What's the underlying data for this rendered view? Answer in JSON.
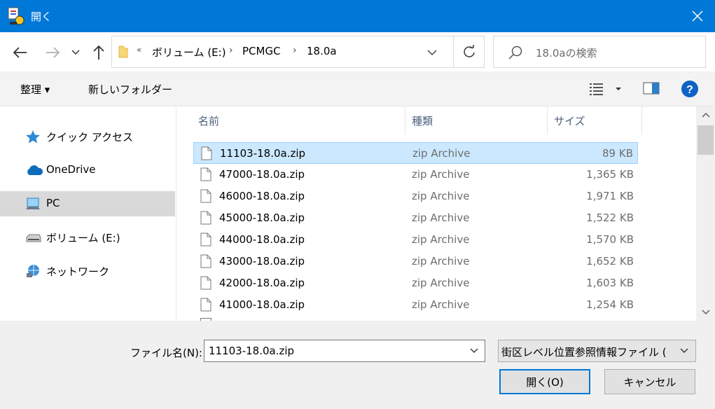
{
  "window": {
    "title": "開く",
    "close_icon": "close-icon"
  },
  "nav": {
    "back_icon": "arrow-left-icon",
    "forward_icon": "arrow-right-icon",
    "recent_icon": "chevron-down-icon",
    "up_icon": "arrow-up-icon"
  },
  "address": {
    "overflow": "«",
    "crumbs": [
      "ボリューム (E:)",
      "PCMGC",
      "18.0a"
    ],
    "separator": "›"
  },
  "search": {
    "placeholder": "18.0aの検索"
  },
  "toolbar": {
    "organize_label": "整理 ▾",
    "new_folder_label": "新しいフォルダー"
  },
  "sidebar": {
    "items": [
      {
        "label": "クイック アクセス",
        "icon": "star-icon"
      },
      {
        "label": "OneDrive",
        "icon": "cloud-icon"
      },
      {
        "label": "PC",
        "icon": "computer-icon",
        "selected": true
      },
      {
        "label": "ボリューム (E:)",
        "icon": "drive-icon"
      },
      {
        "label": "ネットワーク",
        "icon": "network-icon"
      }
    ]
  },
  "columns": {
    "name": "名前",
    "type": "種類",
    "size": "サイズ"
  },
  "files": [
    {
      "name": "11103-18.0a.zip",
      "type": "zip Archive",
      "size": "89 KB",
      "selected": true
    },
    {
      "name": "47000-18.0a.zip",
      "type": "zip Archive",
      "size": "1,365 KB"
    },
    {
      "name": "46000-18.0a.zip",
      "type": "zip Archive",
      "size": "1,971 KB"
    },
    {
      "name": "45000-18.0a.zip",
      "type": "zip Archive",
      "size": "1,522 KB"
    },
    {
      "name": "44000-18.0a.zip",
      "type": "zip Archive",
      "size": "1,570 KB"
    },
    {
      "name": "43000-18.0a.zip",
      "type": "zip Archive",
      "size": "1,652 KB"
    },
    {
      "name": "42000-18.0a.zip",
      "type": "zip Archive",
      "size": "1,603 KB"
    },
    {
      "name": "41000-18.0a.zip",
      "type": "zip Archive",
      "size": "1,254 KB"
    }
  ],
  "bottom": {
    "filename_label": "ファイル名(N):",
    "filename_value": "11103-18.0a.zip",
    "filter_value": "街区レベル位置参照情報ファイル (",
    "open_label": "開く(O)",
    "cancel_label": "キャンセル"
  },
  "colors": {
    "titlebar": "#0078d7",
    "selection": "#cce8ff",
    "selection_border": "#99d1ff"
  }
}
